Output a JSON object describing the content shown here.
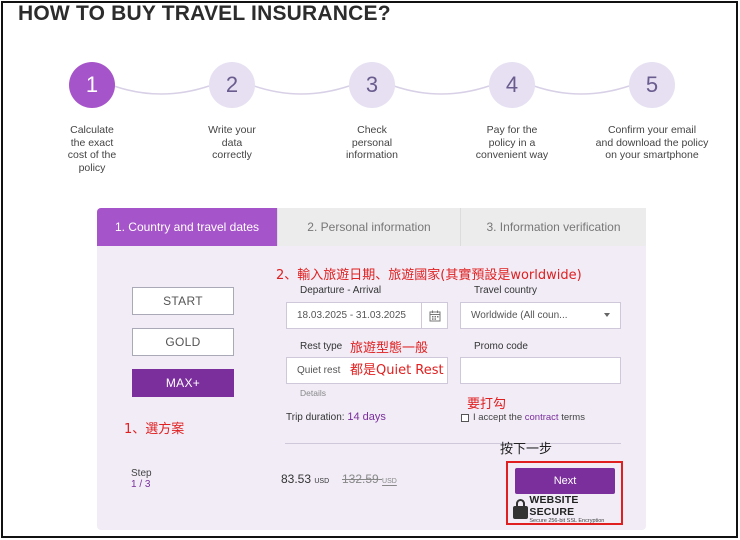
{
  "page": {
    "title": "HOW TO BUY TRAVEL INSURANCE?"
  },
  "steps": [
    {
      "number": "1",
      "caption_lines": [
        "Calculate",
        "the exact",
        "cost of the",
        "policy"
      ],
      "active": true
    },
    {
      "number": "2",
      "caption_lines": [
        "Write your",
        "data",
        "correctly"
      ],
      "active": false
    },
    {
      "number": "3",
      "caption_lines": [
        "Check",
        "personal",
        "information"
      ],
      "active": false
    },
    {
      "number": "4",
      "caption_lines": [
        "Pay for the",
        "policy in a",
        "convenient way"
      ],
      "active": false
    },
    {
      "number": "5",
      "caption_lines": [
        "Confirm your email",
        "and download the policy",
        "on your smartphone"
      ],
      "active": false
    }
  ],
  "tabs": [
    {
      "label": "1. Country and travel dates",
      "active": true
    },
    {
      "label": "2. Personal information",
      "active": false
    },
    {
      "label": "3. Information verification",
      "active": false
    }
  ],
  "plans": [
    {
      "label": "START",
      "selected": false
    },
    {
      "label": "GOLD",
      "selected": false
    },
    {
      "label": "MAX+",
      "selected": true
    }
  ],
  "form": {
    "dates_label": "Departure - Arrival",
    "dates_value": "18.03.2025 - 31.03.2025",
    "country_label": "Travel country",
    "country_value": "Worldwide (All coun...",
    "rest_label": "Rest type",
    "rest_value": "Quiet rest",
    "promo_label": "Promo code",
    "promo_value": "",
    "details_link": "Details",
    "trip_duration_label": "Trip duration:",
    "trip_duration_value": "14 days",
    "accept_prefix": "I accept the ",
    "accept_link": "contract",
    "accept_suffix": " terms"
  },
  "footer": {
    "step_label": "Step",
    "step_current": "1",
    "step_sep": "/",
    "step_total": "3",
    "price": "83.53",
    "price_currency": "USD",
    "old_price": "132.59",
    "old_price_currency": "USD",
    "next_label": "Next",
    "secure_main": "WEBSITE SECURE",
    "secure_sub": "Secure 256-bit SSL Encryption"
  },
  "annotations": {
    "dates_note": "2、輸入旅遊日期、旅遊國家(其實預設是worldwide)",
    "rest_note_line1": "旅遊型態一般",
    "rest_note_line2": "都是Quiet Rest",
    "check_note": "要打勾",
    "plan_note": "1、選方案",
    "next_note": "按下一步"
  },
  "colors": {
    "accent_purple": "#a654c9",
    "dark_purple": "#7a2f9c",
    "annotation_red": "#e02020",
    "card_bg": "#f1ecf6"
  }
}
